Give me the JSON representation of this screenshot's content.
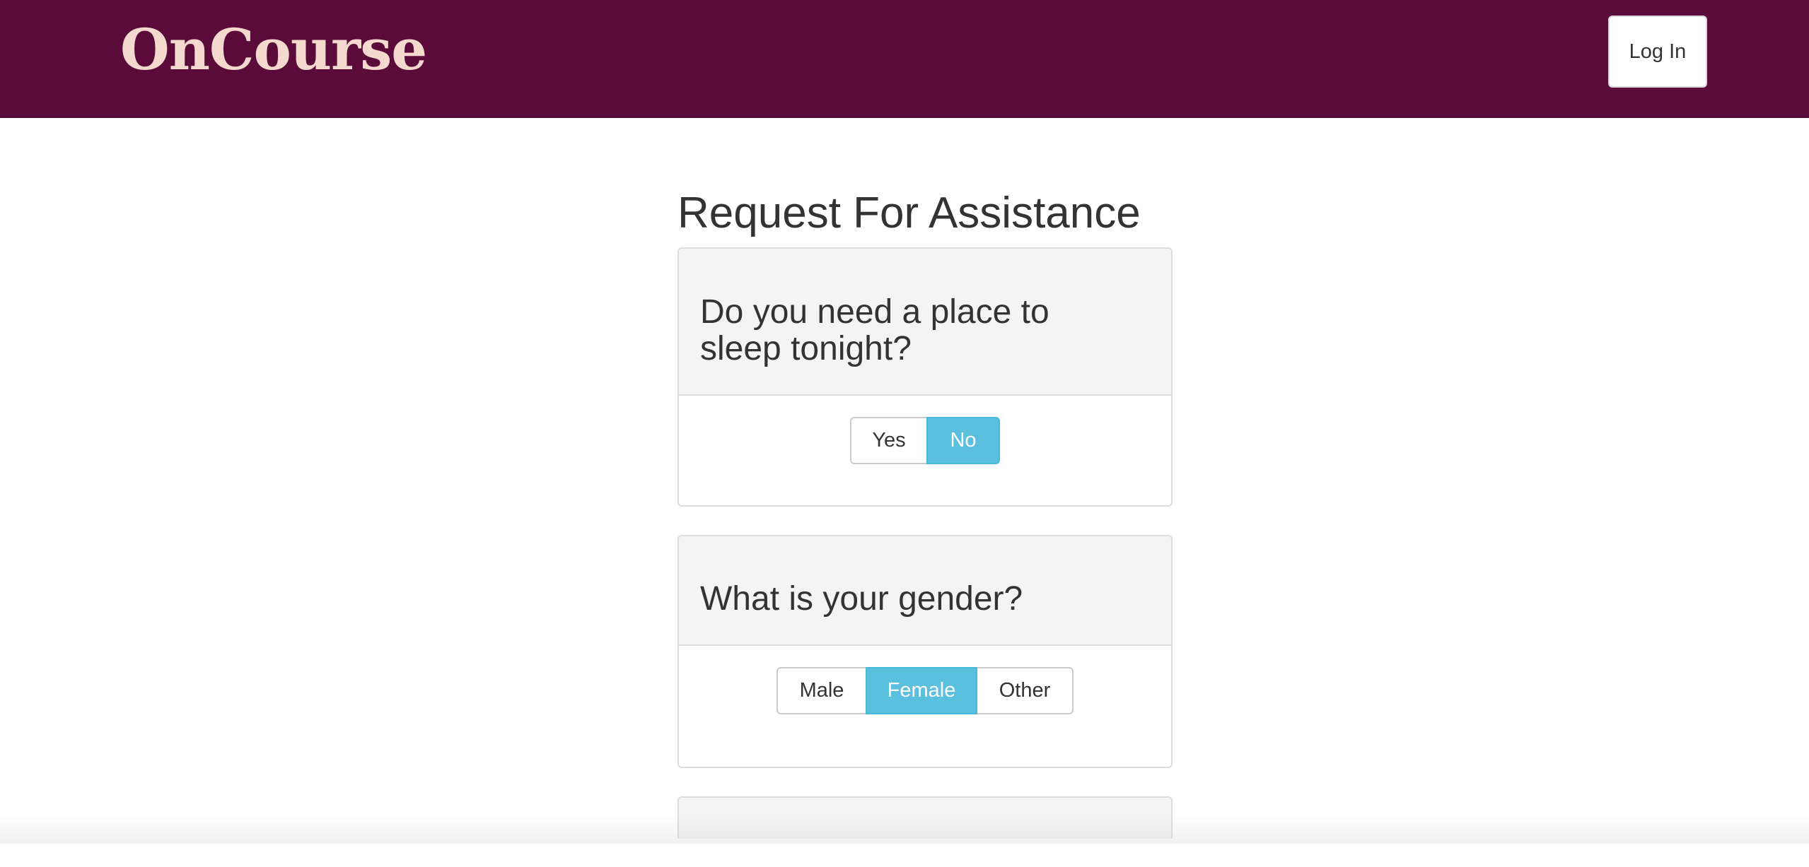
{
  "header": {
    "brand": "OnCourse",
    "login_label": "Log In",
    "background_color": "#5b0b39"
  },
  "main": {
    "title": "Request For Assistance",
    "questions": [
      {
        "text": "Do you need a place to sleep tonight?",
        "options": [
          "Yes",
          "No"
        ],
        "selected": "No"
      },
      {
        "text": "What is your gender?",
        "options": [
          "Male",
          "Female",
          "Other"
        ],
        "selected": "Female"
      }
    ]
  },
  "colors": {
    "selected": "#5bc0de"
  }
}
